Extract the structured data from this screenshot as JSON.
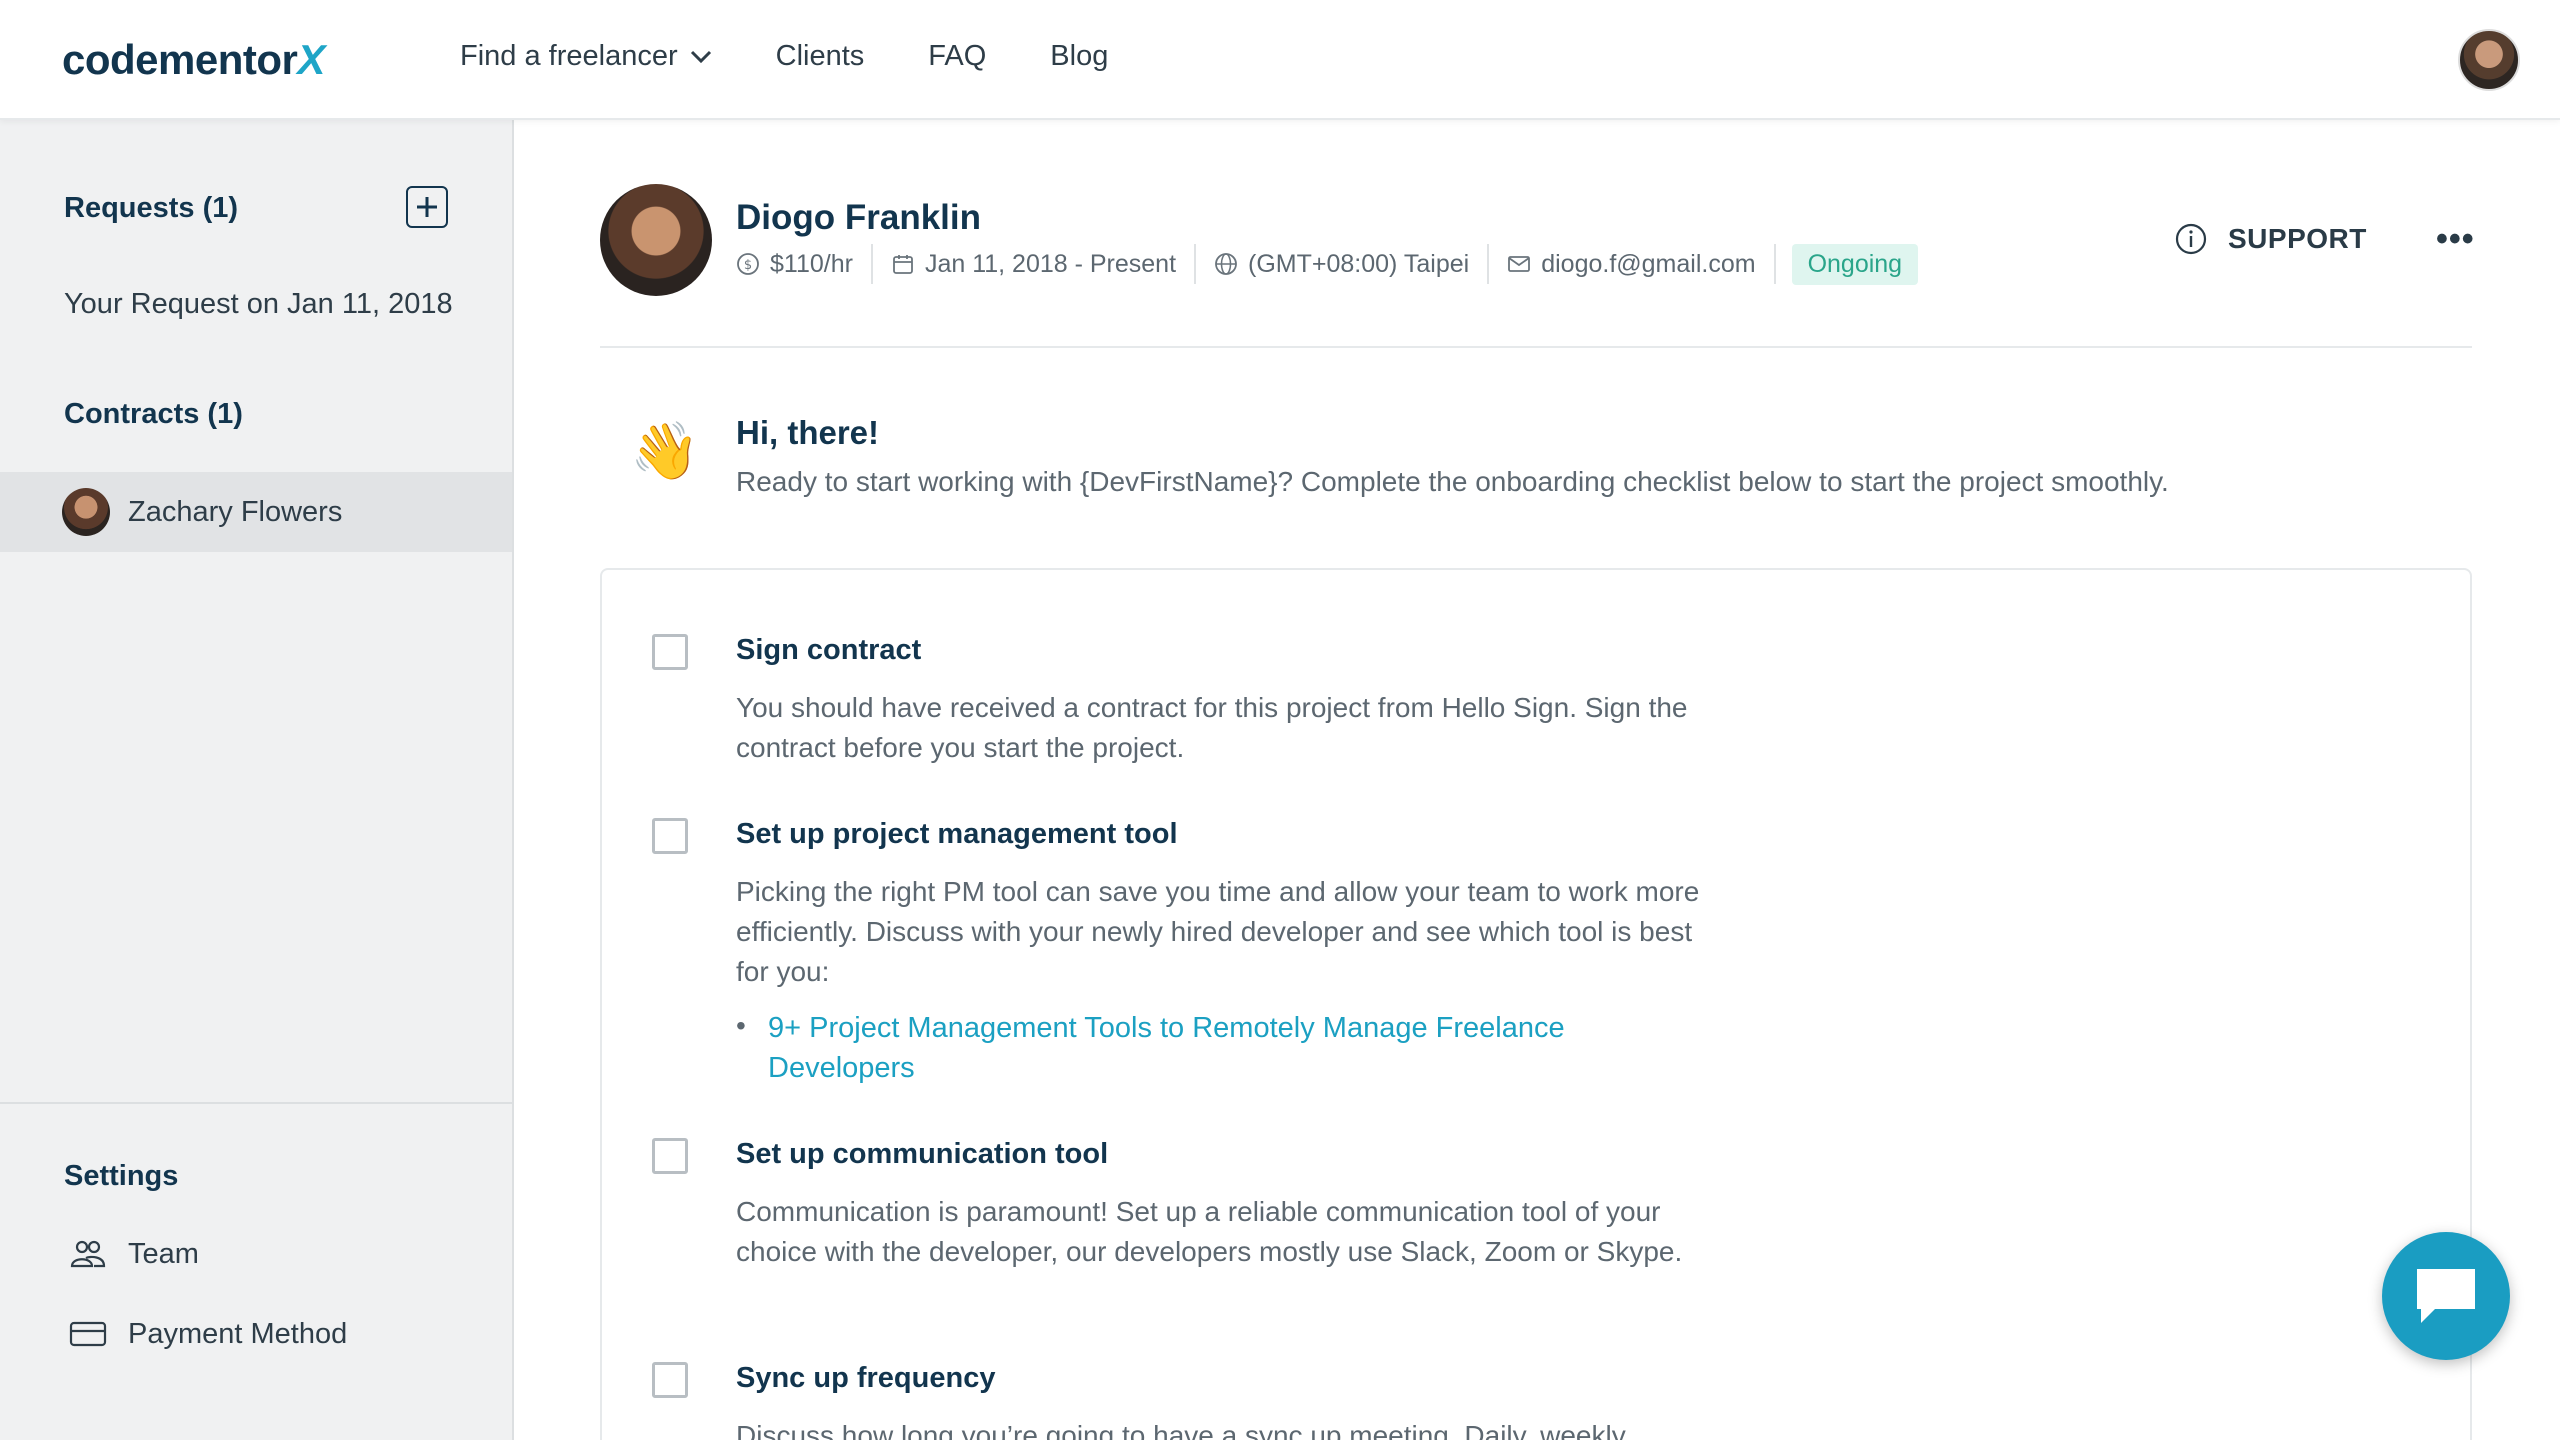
{
  "logo": {
    "main": "codementor",
    "x": "X"
  },
  "nav": {
    "find": "Find a freelancer",
    "clients": "Clients",
    "faq": "FAQ",
    "blog": "Blog"
  },
  "sidebar": {
    "requests_heading": "Requests (1)",
    "request_item": "Your Request on Jan 11, 2018",
    "contracts_heading": "Contracts (1)",
    "contract_item": "Zachary Flowers",
    "settings_heading": "Settings",
    "team": "Team",
    "payment": "Payment Method"
  },
  "profile": {
    "name": "Diogo Franklin",
    "rate": "$110/hr",
    "dates": "Jan 11, 2018 - Present",
    "timezone": "(GMT+08:00) Taipei",
    "email": "diogo.f@gmail.com",
    "status": "Ongoing",
    "support": "SUPPORT",
    "more": "•••"
  },
  "greeting": {
    "emoji": "👋",
    "title": "Hi, there!",
    "subtitle": "Ready to start working with {DevFirstName}? Complete the onboarding checklist below to start the project smoothly."
  },
  "checklist": [
    {
      "title": "Sign contract",
      "desc": "You should have received a contract for this project from Hello Sign. Sign the contract before you start the project."
    },
    {
      "title": "Set up project management tool",
      "desc": "Picking the right PM tool can save you time and allow your team to work more efficiently. Discuss with your newly hired developer and see which tool is best for you:",
      "bullet": "•",
      "link": "9+ Project Management Tools to Remotely Manage Freelance Developers"
    },
    {
      "title": "Set up communication tool",
      "desc": "Communication is paramount! Set up a reliable communication tool of your choice with the developer, our developers mostly use Slack, Zoom or Skype."
    },
    {
      "title": "Sync up frequency",
      "desc": "Discuss how long you’re going to have a sync up meeting. Daily, weekly"
    }
  ],
  "colors": {
    "brand": "#12354e",
    "accent": "#1ea5c7",
    "status_bg": "#dff5ef",
    "status_text": "#2aa58a"
  }
}
